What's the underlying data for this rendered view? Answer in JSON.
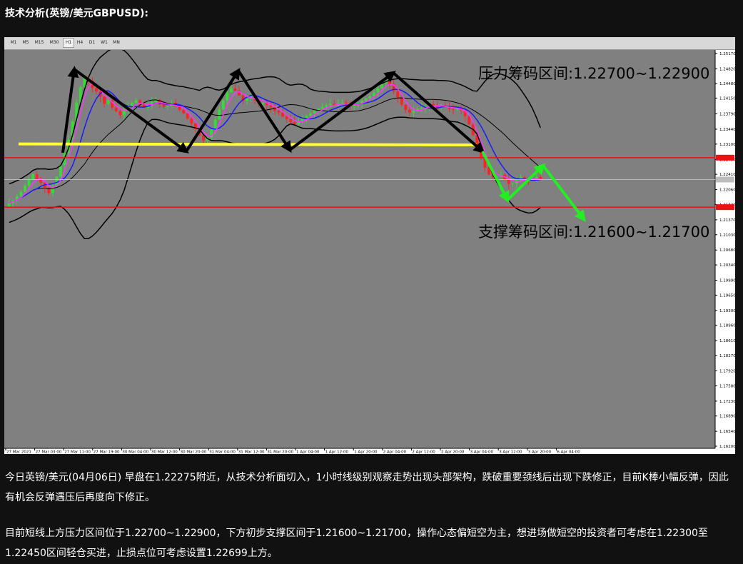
{
  "title": "技术分析(英镑/美元GBPUSD):",
  "timeframes": [
    "M1",
    "M5",
    "M15",
    "M30",
    "H1",
    "H4",
    "D1",
    "W1",
    "MN"
  ],
  "active_timeframe": "H1",
  "chart_data": {
    "type": "candlestick",
    "symbol": "GBPUSD",
    "timeframe": "H1",
    "ylim": [
      1.162,
      1.252
    ],
    "y_ticks": [
      "1.25170",
      "1.24820",
      "1.24480",
      "1.24150",
      "1.23790",
      "1.23440",
      "1.23100",
      "1.22750",
      "1.22410",
      "1.22060",
      "1.21720",
      "1.21370",
      "1.21030",
      "1.20680",
      "1.20340",
      "1.19990",
      "1.19650",
      "1.19300",
      "1.18960",
      "1.18610",
      "1.18270",
      "1.17920",
      "1.17580",
      "1.17230",
      "1.16890",
      "1.16540",
      "1.16200"
    ],
    "x_ticks": [
      "27 Mar 2021",
      "27 Mar 03:00",
      "27 Mar 11:00",
      "27 Mar 19:00",
      "30 Mar 04:00",
      "30 Mar 12:00",
      "30 Mar 20:00",
      "31 Mar 04:00",
      "31 Mar 12:00",
      "31 Mar 20:00",
      "1 Apr 04:00",
      "1 Apr 12:00",
      "1 Apr 20:00",
      "2 Apr 04:00",
      "2 Apr 12:00",
      "2 Apr 20:00",
      "3 Apr 04:00",
      "3 Apr 12:00",
      "3 Apr 20:00",
      "6 Apr 04:00"
    ],
    "closes": [
      1.2175,
      1.2182,
      1.219,
      1.2201,
      1.2215,
      1.2228,
      1.2241,
      1.223,
      1.2222,
      1.221,
      1.2198,
      1.2213,
      1.2236,
      1.2262,
      1.229,
      1.232,
      1.2362,
      1.2405,
      1.244,
      1.246,
      1.2455,
      1.2438,
      1.243,
      1.2418,
      1.2402,
      1.241,
      1.2393,
      1.2385,
      1.2376,
      1.239,
      1.2398,
      1.2404,
      1.241,
      1.24,
      1.2393,
      1.2399,
      1.2406,
      1.2411,
      1.2402,
      1.2395,
      1.2397,
      1.2404,
      1.2396,
      1.2388,
      1.238,
      1.2368,
      1.2357,
      1.2344,
      1.233,
      1.2318,
      1.2325,
      1.2343,
      1.2366,
      1.2389,
      1.241,
      1.2428,
      1.2437,
      1.2432,
      1.2421,
      1.2409,
      1.2414,
      1.242,
      1.241,
      1.2402,
      1.2405,
      1.2399,
      1.2394,
      1.2386,
      1.2382,
      1.2373,
      1.2367,
      1.236,
      1.2355,
      1.2362,
      1.2369,
      1.2375,
      1.238,
      1.2386,
      1.2391,
      1.2395,
      1.2399,
      1.2402,
      1.2398,
      1.2402,
      1.2405,
      1.2401,
      1.2397,
      1.24,
      1.2404,
      1.2409,
      1.2414,
      1.2419,
      1.2428,
      1.2437,
      1.2448,
      1.2455,
      1.2447,
      1.243,
      1.2414,
      1.24,
      1.2388,
      1.2382,
      1.2386,
      1.239,
      1.2393,
      1.2397,
      1.2401,
      1.2397,
      1.2393,
      1.2399,
      1.2395,
      1.239,
      1.2389,
      1.2392,
      1.2387,
      1.2374,
      1.2355,
      1.233,
      1.2303,
      1.2277,
      1.2256,
      1.224,
      1.2234,
      1.2236,
      1.224,
      1.223,
      1.2219,
      1.222,
      1.2228,
      1.2234,
      1.223,
      1.2226,
      1.2229,
      1.2235,
      1.223
    ],
    "annotations": {
      "resistance": "压力筹码区间:1.22700~1.22900",
      "support": "支撑筹码区间:1.21600~1.21700"
    },
    "horizontal_lines": {
      "resistance_level": 1.2279,
      "support_level": 1.2166,
      "current_price": 1.2229,
      "neckline": 1.2312
    },
    "colors": {
      "background": "#808080",
      "bull": "#33dd33",
      "bear": "#ff2222",
      "bands": "#000000",
      "ma_fast": "#ff33ff",
      "ma_slow": "#1a1aff",
      "neckline": "#ffff33",
      "levels": "#ee1111",
      "arrows_black": "#000000",
      "arrows_green": "#22ee22"
    }
  },
  "paragraphs": [
    "今日英镑/美元(04月06日) 早盘在1.22275附近，从技术分析面切入，1小时线级别观察走势出现头部架构，跌破重要颈线后出现下跌修正，目前K棒小幅反弹，因此有机会反弹遇压后再度向下修正。",
    "目前短线上方压力区间位于1.22700~1.22900，下方初步支撑区间于1.21600~1.21700，操作心态偏短空为主，想进场做短空的投资者可考虑在1.22300至1.22450区间轻仓买进，止损点位可考虑设置1.22699上方。"
  ]
}
